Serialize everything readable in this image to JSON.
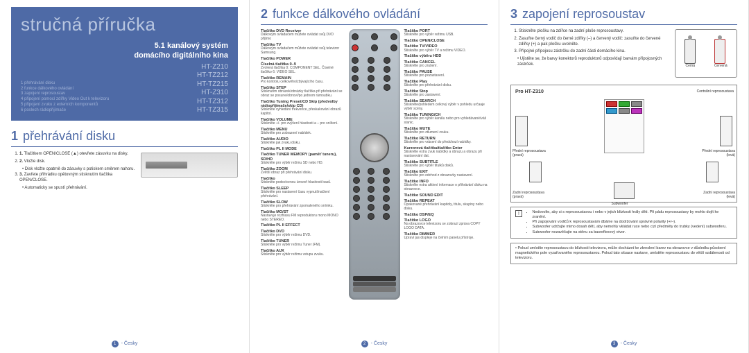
{
  "panel1": {
    "title": "stručná příručka",
    "subtitle1": "5.1 kanálový systém",
    "subtitle2": "domácího digitálního kina",
    "models": [
      "HT-Z210",
      "HT-TZ212",
      "HT-TZ215",
      "HT-Z310",
      "HT-TZ312",
      "HT-TZ315"
    ],
    "toc": [
      "1 přehrávání disku",
      "2 funkce dálkového ovládání",
      "3 zapojení reprosoustav",
      "4 připojení pomocí zdířky Video Out k televizoru",
      "5 připojení zvuku z externích komponentů",
      "6 poslech rádiopřijímače"
    ],
    "sec_num": "1",
    "sec_title": "přehrávání disku",
    "steps": [
      {
        "b": "1.",
        "t": "Tlačítkem OPEN/CLOSE (▲) otevřete zásuvku na disky."
      },
      {
        "b": "2.",
        "t": "Vložte disk."
      },
      {
        "b": "",
        "t": "• Disk vložte opatrně do zásuvky s potiskem směrem nahoru."
      },
      {
        "b": "3.",
        "t": "Zavřete přihrádku opětovným stisknutím tlačítka OPEN/CLOSE."
      },
      {
        "b": "",
        "t": "• Automaticky se spustí přehrávání."
      }
    ],
    "footer_num": "1",
    "footer_lang": "- Česky"
  },
  "panel2": {
    "sec_num": "2",
    "sec_title": "funkce dálkového ovládání",
    "left_funcs": [
      {
        "b": "Tlačítko DVD Receiver",
        "d": "Dálkovým ovladačem můžete ovládat svůj DVD přijímo"
      },
      {
        "b": "Tlačítko TV",
        "d": "Dálkovým ovladačem můžete ovládat svůj televizor Samsung."
      },
      {
        "b": "Tlačítko POWER",
        "d": ""
      },
      {
        "b": "Číselná tlačítka 0–9",
        "d": "Zvolená tlačítka 0: COMPONENT SEL. Číselné tlačítko 6: VIDEO SEL."
      },
      {
        "b": "Tlačítko REMAIN",
        "d": "Pro kontrolu celkového/zbývajícího času."
      },
      {
        "b": "Tlačítko STEP",
        "d": "Stisknutím obrázek/obrázky tlačítka při přehrávání se obraz se posune/obnoví/po jednom rámoubku."
      },
      {
        "b": "Tlačítko Tuning Preset/CD Skip (předvolby rádiopřijímače/skip CD)",
        "d": "Stiskněte vyhledání frekvence, přeskakování obrazů kapitol."
      },
      {
        "b": "Tlačítko VOLUME",
        "d": "Stiskněte +/- pro zvýšení hlasitosti a – pro snížení."
      },
      {
        "b": "Tlačítko MENU",
        "d": "Stiskněte pro zobrazení nabídek."
      },
      {
        "b": "Tlačítko AUDIO",
        "d": "Stiskněte jak zvuku disku."
      },
      {
        "b": "Tlačítko PL II MODE",
        "d": ""
      },
      {
        "b": "Tlačítko TUNER MEMORY (paměť tuneru), SD/HD",
        "d": "Stiskněte pro výběr režimu SD nebo HD."
      },
      {
        "b": "Tlačítko ZOOM",
        "d": "Zvětší obraz při přehrávání disku."
      },
      {
        "b": "Tlačítko",
        "d": "Stiskněte podsvícenou úroveň hlasitosti basů."
      },
      {
        "b": "Tlačítko SLEEP",
        "d": "Stiskněte pro nastavení času vypnutí/načtení přehrávání."
      },
      {
        "b": "Tlačítko SLOW",
        "d": "Stiskněte pro přehrávání zpomaleného snímku."
      },
      {
        "b": "Tlačítko MO/ST",
        "d": "Nastavuje rozhlasu FM reproduktoru mono MONO nebo STEREO."
      },
      {
        "b": "Tlačítko PL II EFFECT",
        "d": ""
      },
      {
        "b": "Tlačítko DVD",
        "d": "Stiskněte pro výběr režimu DVD."
      },
      {
        "b": "Tlačítko TUNER",
        "d": "Stiskněte pro výběr režimu Tuner (FM)."
      },
      {
        "b": "Tlačítko AUX",
        "d": "Stiskněte pro výběr režimu vstupu zvuku."
      }
    ],
    "right_funcs": [
      {
        "b": "Tlačítko PORT",
        "d": "Stiskněte pro výběr režimu USB."
      },
      {
        "b": "Tlačítko OPEN/CLOSE",
        "d": ""
      },
      {
        "b": "Tlačítko TV/VIDEO",
        "d": "Stiskněte pro výběr TV a režimu VIDEO."
      },
      {
        "b": "Tlačítko výběru HDD",
        "d": ""
      },
      {
        "b": "Tlačítko CANCEL",
        "d": "Stiskněte pro zrušení."
      },
      {
        "b": "Tlačítko PAUSE",
        "d": "Stiskněte pro pozastavení."
      },
      {
        "b": "Tlačítko Play",
        "d": "Stiskněte pro přehrávání disku."
      },
      {
        "b": "Tlačítko Stop",
        "d": "Stiskněte pro zastavení."
      },
      {
        "b": "Tlačítko SEARCH",
        "d": "Stiskněte/pohledem celkový výběr v pohledu určaaje výběr scény."
      },
      {
        "b": "Tlačítko TUNING/CH",
        "d": "Stiskněte pro výběr kanálu nebo pro vyhledávané/váš stanic."
      },
      {
        "b": "Tlačítko MUTE",
        "d": "Stiskněte pro ztlumení zvuku."
      },
      {
        "b": "Tlačítko RETURN",
        "d": "Stiskněte pro vrácení do předchozí nabídky."
      },
      {
        "b": "Kurzorová tlačítka/tlačítko Enter",
        "d": "Stiskněte extra zvuk nabídky a obrazu a obrazu při nastavování dat."
      },
      {
        "b": "Tlačítko SUBTITLE",
        "d": "Stiskněte pro výběr titulků disků."
      },
      {
        "b": "Tlačítko EXIT",
        "d": "Stiskněte pro odchod z obrazovky nastavení."
      },
      {
        "b": "Tlačítko INFO",
        "d": "Stiskněte extra aktivní informace o přihrávání disku na obrazovce."
      },
      {
        "b": "Tlačítko SOUND EDIT",
        "d": ""
      },
      {
        "b": "Tlačítko REPEAT",
        "d": "Opakované přehrávání kapitoly, titulu, skupiny nebo disku."
      },
      {
        "b": "Tlačítko DSP/EQ",
        "d": ""
      },
      {
        "b": "Tlačítko LOGO",
        "d": "Na obrazovce televizoru se zobrazí zpráva COPY LOGO DATA."
      },
      {
        "b": "Tlačítko DIMMER",
        "d": "Upraví jas displeje na čelním panelu přístroje."
      }
    ],
    "footer_num": "2",
    "footer_lang": "- Česky"
  },
  "panel3": {
    "sec_num": "3",
    "sec_title": "zapojení reprosoustav",
    "steps": [
      "Stiskněte plošku na zdířce na zadní ploše reprosoustavy.",
      "Zasuňte černý vodič do černé zdířky (–) a červený vodič: zasuňte do červené zdířky (+) a pak plošku uvolněte.",
      "Přípojné přípojosu zástrčku do zadní části domácího kina."
    ],
    "step3_sub": "• Ujistěte se, že barvy konektorů reproduktorů odpovídají barvám přípojosných zástrček.",
    "plug_black": "Černá",
    "plug_red": "Červená",
    "layout_lbl": "Pro HT-Z310",
    "labels": {
      "center": "Centrální reprosoustava",
      "frontR": "Přední reprosoustava (pravá)",
      "frontL": "Přední reprosoustava (levá)",
      "rearR": "Zadní reprosoustava (pravá)",
      "rearL": "Zadní reprosoustava (levá)",
      "sub": "Subwoofer"
    },
    "note1_icon": "!",
    "note1": [
      "Nedovolte, aby si s reprosoustavou i nebo v jejich blízkosti hrály děti. Při pádu reprosoustavy by mohlo dojít ke zranění.",
      "Při zapojování vodičů k reprosoustavám dbáme na dodržování správné polarity (+/–).",
      "Subwoofer udržujte mimo dosah dětí, aby nemohly vkládat ruce nebo cizí předměty do trubky (vedení) subwooferu.",
      "Subwoofer nezavěšujte na stěnu za basreflexový otvor."
    ],
    "note2": "• Pokud umístíte reprosoustavu do blízkosti televizoru, může docházet ke zkreslení barev na obrazovce v důsledku působení magnetického pole vyzařovaného reprosoustavou. Pokud tato situace nastane, umístěte reprosoustavu do větší vzdálenosti od televizoru.",
    "footer_num": "3",
    "footer_lang": "- Česky"
  }
}
